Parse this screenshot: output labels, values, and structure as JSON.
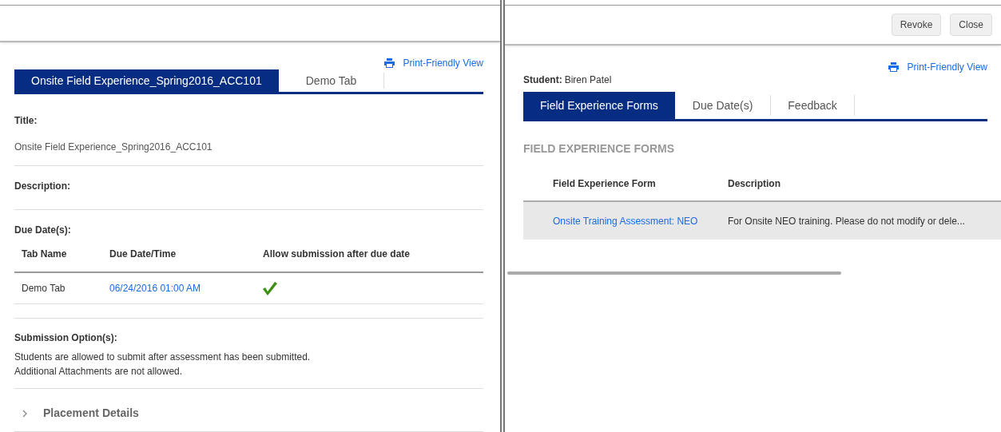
{
  "left_panel": {
    "print_link": "Print-Friendly View",
    "tabs": [
      {
        "label": "Onsite Field Experience_Spring2016_ACC101",
        "selected": true
      },
      {
        "label": "Demo Tab",
        "selected": false
      }
    ],
    "title_label": "Title:",
    "title_value": "Onsite Field Experience_Spring2016_ACC101",
    "description_label": "Description:",
    "due_dates_label": "Due Date(s):",
    "due_table": {
      "columns": [
        "Tab Name",
        "Due Date/Time",
        "Allow submission after due date"
      ],
      "rows": [
        {
          "tab_name": "Demo Tab",
          "due": "06/24/2016 01:00 AM",
          "allowed": true
        }
      ]
    },
    "submission_label": "Submission Option(s):",
    "submission_lines": [
      "Students are allowed to submit after assessment has been submitted.",
      "Additional Attachments are not allowed."
    ],
    "placement": {
      "label": "Placement Details",
      "expanded": false
    }
  },
  "right_panel": {
    "buttons": [
      "Revoke",
      "Close"
    ],
    "print_link": "Print-Friendly View",
    "student_label": "Student:",
    "student_name": "Biren Patel",
    "tabs": [
      {
        "label": "Field Experience Forms",
        "selected": true
      },
      {
        "label": "Due Date(s)",
        "selected": false
      },
      {
        "label": "Feedback",
        "selected": false
      }
    ],
    "section_heading": "FIELD EXPERIENCE FORMS",
    "forms_table": {
      "columns": [
        "Field Experience Form",
        "Description"
      ],
      "rows": [
        {
          "form": "Onsite Training Assessment: NEO",
          "description": "For Onsite NEO training. Please do not modify or dele..."
        }
      ]
    }
  }
}
